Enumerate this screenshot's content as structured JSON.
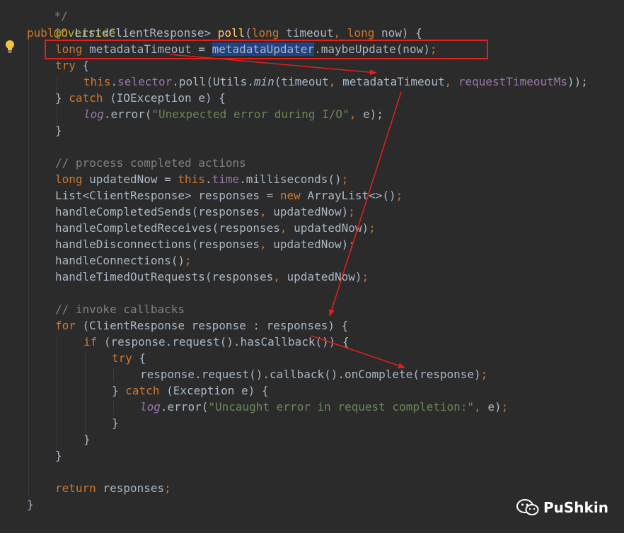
{
  "code": {
    "l0": "*/",
    "l1_ann": "@Override",
    "l2_public": "public",
    "l2_type": "List<ClientResponse>",
    "l2_fn": "poll",
    "l2_open": "(",
    "l2_long1": "long",
    "l2_p1": "timeout",
    "l2_comma": ",",
    "l2_long2": "long",
    "l2_p2": "now",
    "l2_close": ") {",
    "l3_long": "long",
    "l3_var": "metadataTimeout =",
    "l3_sel": "metadataUpdater",
    "l3_call": ".maybeUpdate(now)",
    "l3_semi": ";",
    "l4_try": "try",
    "l4_brace": "{",
    "l5_this": "this",
    "l5_dot": ".",
    "l5_selector": "selector",
    "l5_poll": ".poll(Utils.",
    "l5_min": "min",
    "l5_args": "(timeout",
    "l5_c1": ",",
    "l5_mt": "metadataTimeout",
    "l5_c2": ",",
    "l5_rt": "requestTimeoutMs",
    "l5_end": "));",
    "l6_brace": "}",
    "l6_catch": "catch",
    "l6_rest": "(IOException e) {",
    "l7_log": "log",
    "l7_err": ".error(",
    "l7_str": "\"Unexpected error during I/O\"",
    "l7_comma": ",",
    "l7_end": "e);",
    "l8": "}",
    "l10_cm": "// process completed actions",
    "l11_long": "long",
    "l11_var": "updatedNow =",
    "l11_this": "this",
    "l11_dot": ".",
    "l11_time": "time",
    "l11_ms": ".milliseconds()",
    "l11_semi": ";",
    "l12_a": "List<ClientResponse> responses =",
    "l12_new": "new",
    "l12_b": "ArrayList<>()",
    "l12_semi": ";",
    "l13_a": "handleCompletedSends(responses",
    "l13_c": ",",
    "l13_b": "updatedNow)",
    "l13_semi": ";",
    "l14_a": "handleCompletedReceives(responses",
    "l14_c": ",",
    "l14_b": "updatedNow)",
    "l14_semi": ";",
    "l15_a": "handleDisconnections(responses",
    "l15_c": ",",
    "l15_b": "updatedNow)",
    "l15_semi": ";",
    "l16_a": "handleConnections()",
    "l16_semi": ";",
    "l17_a": "handleTimedOutRequests(responses",
    "l17_c": ",",
    "l17_b": "updatedNow)",
    "l17_semi": ";",
    "l19_cm": "// invoke callbacks",
    "l20_for": "for",
    "l20_rest": "(ClientResponse response : responses) {",
    "l21_if": "if",
    "l21_rest": "(response.request().hasCallback()) {",
    "l22_try": "try",
    "l22_brace": "{",
    "l23_a": "response.request().callback().onComplete(response)",
    "l23_semi": ";",
    "l24_brace": "}",
    "l24_catch": "catch",
    "l24_rest": "(Exception e) {",
    "l25_log": "log",
    "l25_err": ".error(",
    "l25_str": "\"Uncaught error in request completion:\"",
    "l25_comma": ",",
    "l25_end": "e)",
    "l25_semi": ";",
    "l26": "}",
    "l27": "}",
    "l28": "}",
    "l30_return": "return",
    "l30_rest": "responses",
    "l30_semi": ";",
    "l31": "}"
  },
  "colors": {
    "background": "#2b2b2b",
    "keyword": "#cc7832",
    "annotation": "#bbb529",
    "method_declaration": "#ffc66d",
    "field": "#9876aa",
    "string": "#6a8759",
    "comment": "#808080",
    "selection": "#214283",
    "annotation_arrow": "#e3201c"
  },
  "icons": {
    "gutter": "lightbulb-icon",
    "watermark": "wechat-icon"
  },
  "watermark": {
    "text": "PuShkin"
  }
}
